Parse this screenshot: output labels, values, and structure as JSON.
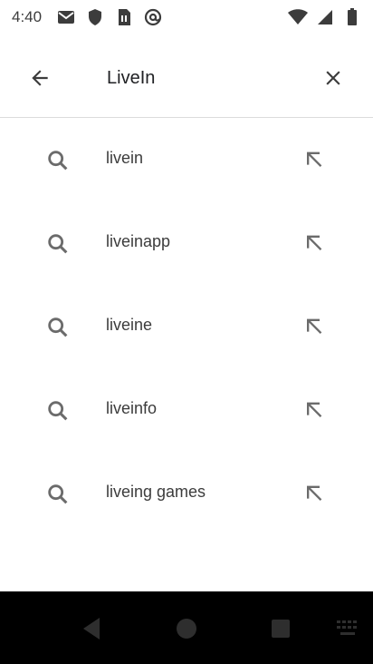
{
  "status_bar": {
    "time": "4:40",
    "left_icons": [
      "gmail-icon",
      "shield-icon",
      "sim-card-icon",
      "at-sign-icon"
    ],
    "right_icons": [
      "wifi-icon",
      "cellular-signal-icon",
      "battery-icon"
    ]
  },
  "search": {
    "query": "LiveIn",
    "back_icon": "arrow-back-icon",
    "clear_icon": "close-icon"
  },
  "suggestions": [
    {
      "label": "livein"
    },
    {
      "label": "liveinapp"
    },
    {
      "label": "liveine"
    },
    {
      "label": "liveinfo"
    },
    {
      "label": "liveing games"
    }
  ],
  "nav_bar": {
    "buttons": [
      "back-triangle-icon",
      "home-circle-icon",
      "recents-square-icon",
      "keyboard-icon"
    ]
  },
  "colors": {
    "icon_gray": "#6b6b6b",
    "text": "#3c3c3c",
    "nav_background": "#000000"
  }
}
